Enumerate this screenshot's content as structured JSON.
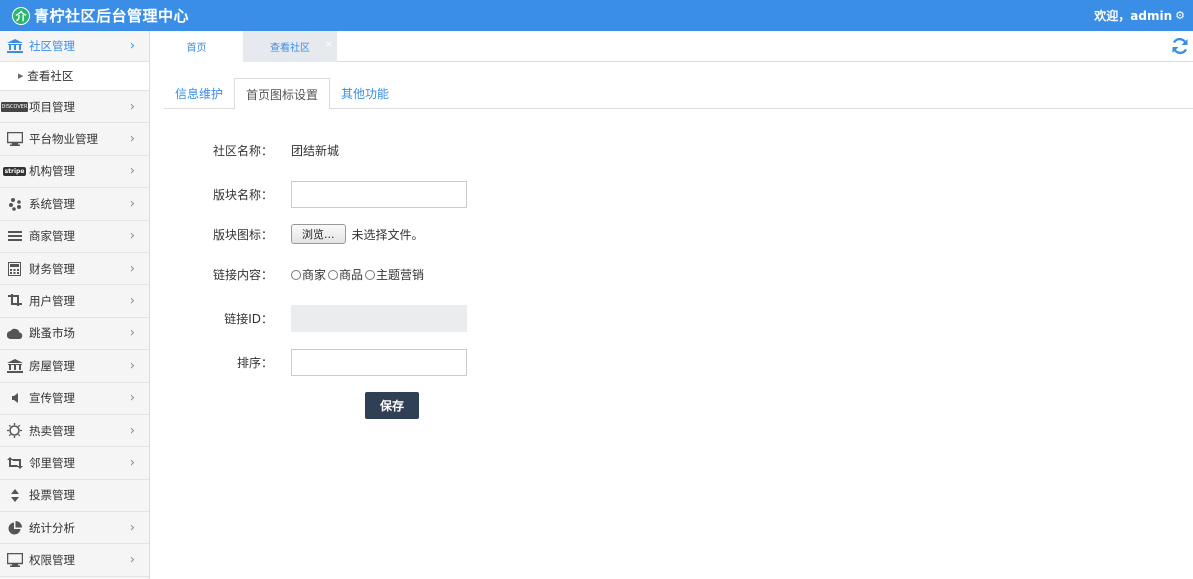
{
  "header": {
    "app_title": "青柠社区后台管理中心",
    "welcome": "欢迎，admin",
    "logo_icon": "leaf-icon",
    "settings_icon": "gear-icon"
  },
  "sidebar": {
    "items": [
      {
        "label": "社区管理",
        "icon": "bank-icon",
        "active": true
      },
      {
        "label": "项目管理",
        "icon": "card-icon"
      },
      {
        "label": "平台物业管理",
        "icon": "monitor-icon"
      },
      {
        "label": "机构管理",
        "icon": "stripe-icon"
      },
      {
        "label": "系统管理",
        "icon": "yelp-icon"
      },
      {
        "label": "商家管理",
        "icon": "list-icon"
      },
      {
        "label": "财务管理",
        "icon": "calculator-icon"
      },
      {
        "label": "用户管理",
        "icon": "crop-icon"
      },
      {
        "label": "跳蚤市场",
        "icon": "cloud-icon"
      },
      {
        "label": "房屋管理",
        "icon": "bank-icon"
      },
      {
        "label": "宣传管理",
        "icon": "volume-icon"
      },
      {
        "label": "热卖管理",
        "icon": "sun-icon"
      },
      {
        "label": "邻里管理",
        "icon": "retweet-icon"
      },
      {
        "label": "投票管理",
        "icon": "sort-icon"
      },
      {
        "label": "统计分析",
        "icon": "pie-chart-icon"
      },
      {
        "label": "权限管理",
        "icon": "desktop-icon"
      }
    ],
    "sub_item": "查看社区"
  },
  "tabbar": {
    "home": "首页",
    "current": "查看社区",
    "close": "×"
  },
  "content_tabs": [
    "信息维护",
    "首页图标设置",
    "其他功能"
  ],
  "form": {
    "community_label": "社区名称：",
    "community_value": "团结新城",
    "block_name_label": "版块名称：",
    "block_name_value": "",
    "block_icon_label": "版块图标：",
    "browse_button": "浏览...",
    "file_status": "未选择文件。",
    "link_content_label": "链接内容：",
    "link_options": [
      "商家",
      "商品",
      "主题营销"
    ],
    "link_id_label": "链接ID：",
    "sort_label": "排序：",
    "save_button": "保存"
  }
}
